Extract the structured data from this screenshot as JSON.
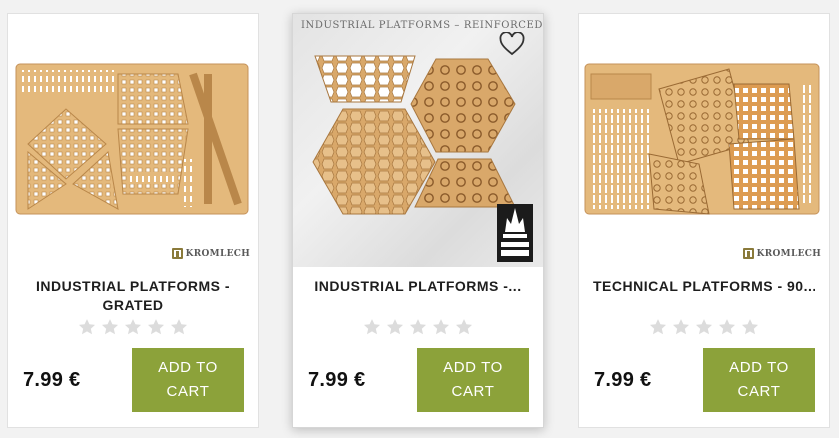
{
  "colors": {
    "accent_button": "#8ca23a",
    "wood": "#e4b97c",
    "wood_dark": "#b9874a",
    "star": "#dcdcdc"
  },
  "products": [
    {
      "title": "INDUSTRIAL PLATFORMS - GRATED",
      "price": "7.99 €",
      "button_label": "ADD TO CART",
      "brand": "KROMLECH",
      "rating": 0,
      "icons": [
        "kromlech-logo-icon",
        "star-icon"
      ]
    },
    {
      "title": "INDUSTRIAL PLATFORMS -...",
      "image_caption": "INDUSTRIAL PLATFORMS – REINFORCED",
      "price": "7.99 €",
      "button_label": "ADD TO CART",
      "badge": "TABLETOP SCENICS",
      "rating": 0,
      "icons": [
        "heart-icon",
        "tabletop-scenics-logo-icon",
        "star-icon"
      ]
    },
    {
      "title": "TECHNICAL PLATFORMS - 90...",
      "price": "7.99 €",
      "button_label": "ADD TO CART",
      "brand": "KROMLECH",
      "rating": 0,
      "icons": [
        "kromlech-logo-icon",
        "star-icon"
      ]
    }
  ]
}
